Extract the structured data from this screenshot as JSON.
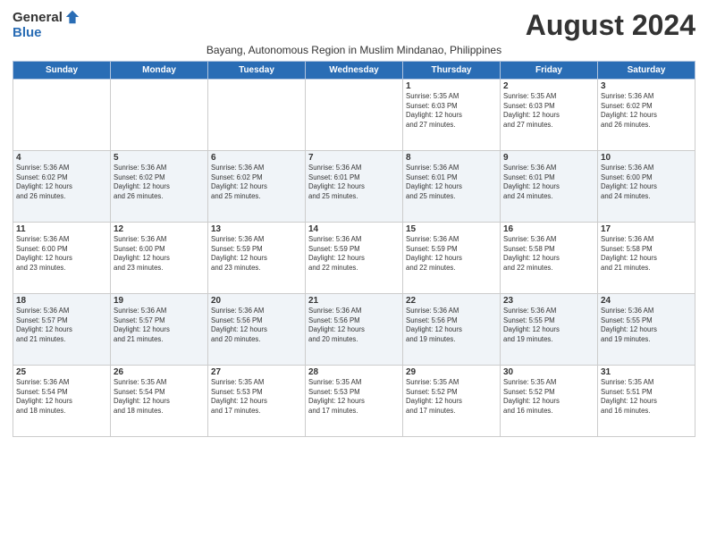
{
  "logo": {
    "general": "General",
    "blue": "Blue"
  },
  "header": {
    "month_title": "August 2024",
    "subtitle": "Bayang, Autonomous Region in Muslim Mindanao, Philippines"
  },
  "days_of_week": [
    "Sunday",
    "Monday",
    "Tuesday",
    "Wednesday",
    "Thursday",
    "Friday",
    "Saturday"
  ],
  "weeks": [
    [
      {
        "day": "",
        "info": ""
      },
      {
        "day": "",
        "info": ""
      },
      {
        "day": "",
        "info": ""
      },
      {
        "day": "",
        "info": ""
      },
      {
        "day": "1",
        "info": "Sunrise: 5:35 AM\nSunset: 6:03 PM\nDaylight: 12 hours\nand 27 minutes."
      },
      {
        "day": "2",
        "info": "Sunrise: 5:35 AM\nSunset: 6:03 PM\nDaylight: 12 hours\nand 27 minutes."
      },
      {
        "day": "3",
        "info": "Sunrise: 5:36 AM\nSunset: 6:02 PM\nDaylight: 12 hours\nand 26 minutes."
      }
    ],
    [
      {
        "day": "4",
        "info": "Sunrise: 5:36 AM\nSunset: 6:02 PM\nDaylight: 12 hours\nand 26 minutes."
      },
      {
        "day": "5",
        "info": "Sunrise: 5:36 AM\nSunset: 6:02 PM\nDaylight: 12 hours\nand 26 minutes."
      },
      {
        "day": "6",
        "info": "Sunrise: 5:36 AM\nSunset: 6:02 PM\nDaylight: 12 hours\nand 25 minutes."
      },
      {
        "day": "7",
        "info": "Sunrise: 5:36 AM\nSunset: 6:01 PM\nDaylight: 12 hours\nand 25 minutes."
      },
      {
        "day": "8",
        "info": "Sunrise: 5:36 AM\nSunset: 6:01 PM\nDaylight: 12 hours\nand 25 minutes."
      },
      {
        "day": "9",
        "info": "Sunrise: 5:36 AM\nSunset: 6:01 PM\nDaylight: 12 hours\nand 24 minutes."
      },
      {
        "day": "10",
        "info": "Sunrise: 5:36 AM\nSunset: 6:00 PM\nDaylight: 12 hours\nand 24 minutes."
      }
    ],
    [
      {
        "day": "11",
        "info": "Sunrise: 5:36 AM\nSunset: 6:00 PM\nDaylight: 12 hours\nand 23 minutes."
      },
      {
        "day": "12",
        "info": "Sunrise: 5:36 AM\nSunset: 6:00 PM\nDaylight: 12 hours\nand 23 minutes."
      },
      {
        "day": "13",
        "info": "Sunrise: 5:36 AM\nSunset: 5:59 PM\nDaylight: 12 hours\nand 23 minutes."
      },
      {
        "day": "14",
        "info": "Sunrise: 5:36 AM\nSunset: 5:59 PM\nDaylight: 12 hours\nand 22 minutes."
      },
      {
        "day": "15",
        "info": "Sunrise: 5:36 AM\nSunset: 5:59 PM\nDaylight: 12 hours\nand 22 minutes."
      },
      {
        "day": "16",
        "info": "Sunrise: 5:36 AM\nSunset: 5:58 PM\nDaylight: 12 hours\nand 22 minutes."
      },
      {
        "day": "17",
        "info": "Sunrise: 5:36 AM\nSunset: 5:58 PM\nDaylight: 12 hours\nand 21 minutes."
      }
    ],
    [
      {
        "day": "18",
        "info": "Sunrise: 5:36 AM\nSunset: 5:57 PM\nDaylight: 12 hours\nand 21 minutes."
      },
      {
        "day": "19",
        "info": "Sunrise: 5:36 AM\nSunset: 5:57 PM\nDaylight: 12 hours\nand 21 minutes."
      },
      {
        "day": "20",
        "info": "Sunrise: 5:36 AM\nSunset: 5:56 PM\nDaylight: 12 hours\nand 20 minutes."
      },
      {
        "day": "21",
        "info": "Sunrise: 5:36 AM\nSunset: 5:56 PM\nDaylight: 12 hours\nand 20 minutes."
      },
      {
        "day": "22",
        "info": "Sunrise: 5:36 AM\nSunset: 5:56 PM\nDaylight: 12 hours\nand 19 minutes."
      },
      {
        "day": "23",
        "info": "Sunrise: 5:36 AM\nSunset: 5:55 PM\nDaylight: 12 hours\nand 19 minutes."
      },
      {
        "day": "24",
        "info": "Sunrise: 5:36 AM\nSunset: 5:55 PM\nDaylight: 12 hours\nand 19 minutes."
      }
    ],
    [
      {
        "day": "25",
        "info": "Sunrise: 5:36 AM\nSunset: 5:54 PM\nDaylight: 12 hours\nand 18 minutes."
      },
      {
        "day": "26",
        "info": "Sunrise: 5:35 AM\nSunset: 5:54 PM\nDaylight: 12 hours\nand 18 minutes."
      },
      {
        "day": "27",
        "info": "Sunrise: 5:35 AM\nSunset: 5:53 PM\nDaylight: 12 hours\nand 17 minutes."
      },
      {
        "day": "28",
        "info": "Sunrise: 5:35 AM\nSunset: 5:53 PM\nDaylight: 12 hours\nand 17 minutes."
      },
      {
        "day": "29",
        "info": "Sunrise: 5:35 AM\nSunset: 5:52 PM\nDaylight: 12 hours\nand 17 minutes."
      },
      {
        "day": "30",
        "info": "Sunrise: 5:35 AM\nSunset: 5:52 PM\nDaylight: 12 hours\nand 16 minutes."
      },
      {
        "day": "31",
        "info": "Sunrise: 5:35 AM\nSunset: 5:51 PM\nDaylight: 12 hours\nand 16 minutes."
      }
    ]
  ]
}
